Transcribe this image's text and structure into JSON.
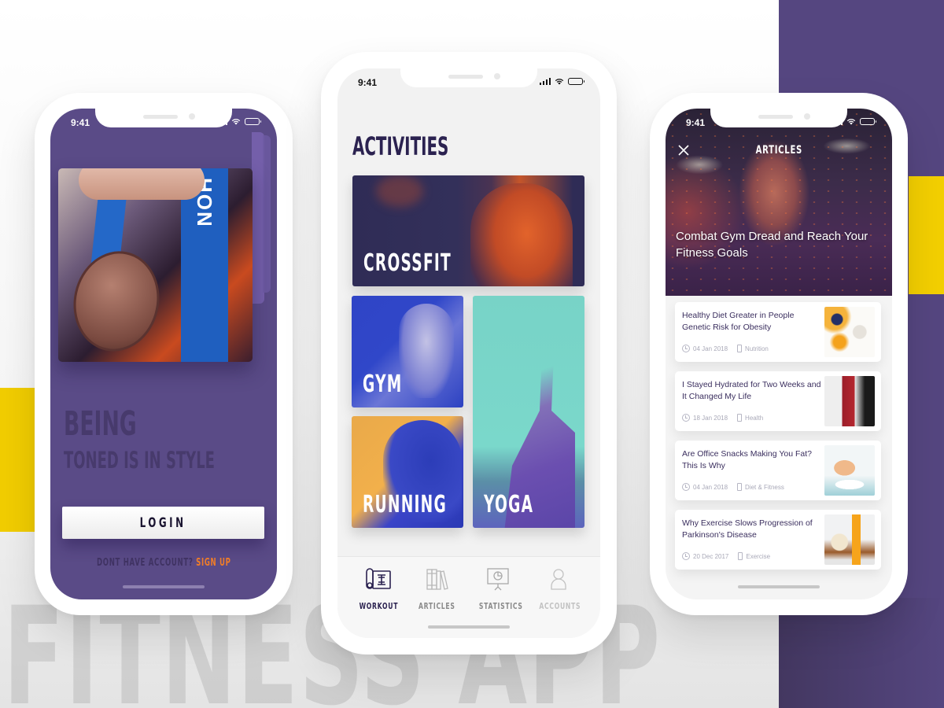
{
  "background": {
    "watermark_text": "FITNESS APP",
    "colors": {
      "purple": "#554680",
      "yellow": "#f3cf00",
      "orange_accent": "#f07d28"
    }
  },
  "status_bar": {
    "time": "9:41"
  },
  "login_screen": {
    "headline": "BEING",
    "subheadline": "TONED IS IN STYLE",
    "login_button": "LOGIN",
    "signup_prompt": "DONT HAVE ACCOUNT?",
    "signup_link": "SIGN UP",
    "medal_ribbon_text": "HON"
  },
  "activities_screen": {
    "title": "ACTIVITIES",
    "tiles": [
      {
        "label": "CROSSFIT"
      },
      {
        "label": "GYM"
      },
      {
        "label": "RUNNING"
      },
      {
        "label": "YOGA"
      }
    ],
    "tabs": [
      {
        "label": "WORKOUT",
        "icon": "workout-icon",
        "active": true
      },
      {
        "label": "ARTICLES",
        "icon": "books-icon",
        "active": false
      },
      {
        "label": "STATISTICS",
        "icon": "presentation-chart-icon",
        "active": false
      },
      {
        "label": "ACCOUNTS",
        "icon": "user-icon",
        "active": false
      }
    ]
  },
  "articles_screen": {
    "nav_title": "ARTICLES",
    "hero_headline": "Combat Gym Dread and Reach Your Fitness Goals",
    "articles": [
      {
        "title": "Healthy Diet Greater in People Genetic Risk for Obesity",
        "date": "04 Jan 2018",
        "category": "Nutrition"
      },
      {
        "title": "I Stayed Hydrated for Two Weeks and It Changed My Life",
        "date": "18 Jan 2018",
        "category": "Health"
      },
      {
        "title": "Are Office Snacks Making You Fat? This Is Why",
        "date": "04 Jan 2018",
        "category": "Diet & Fitness"
      },
      {
        "title": "Why Exercise Slows Progression of Parkinson's Disease",
        "date": "20 Dec 2017",
        "category": "Exercise"
      }
    ]
  }
}
